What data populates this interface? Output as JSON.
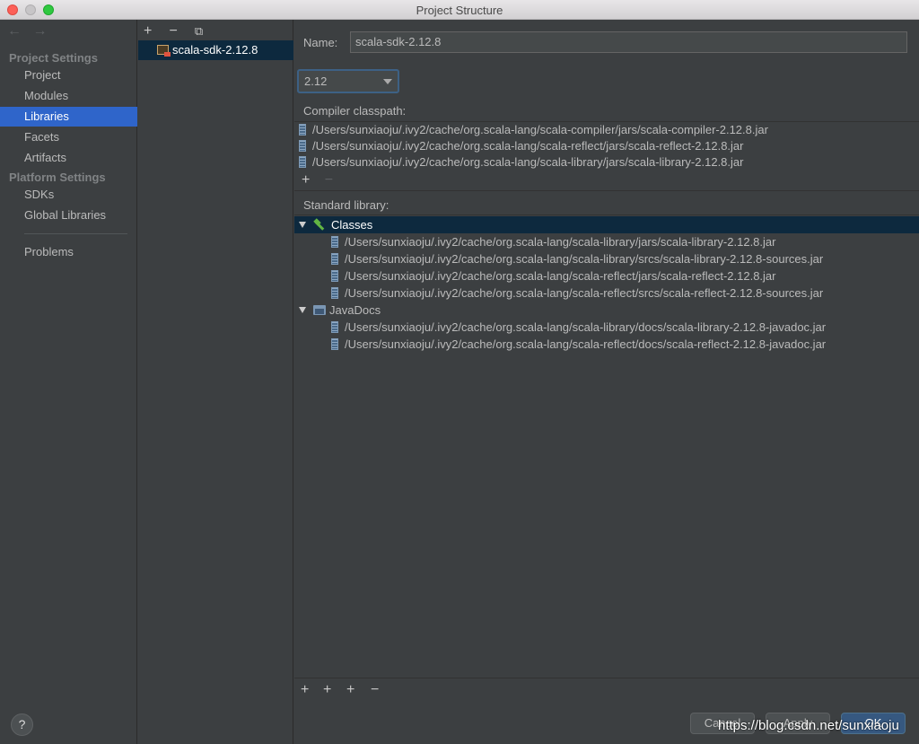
{
  "window": {
    "title": "Project Structure"
  },
  "nav": {
    "back": "←",
    "forward": "→",
    "project_settings": "Project Settings",
    "platform_settings": "Platform Settings",
    "items": {
      "project": "Project",
      "modules": "Modules",
      "libraries": "Libraries",
      "facets": "Facets",
      "artifacts": "Artifacts",
      "sdks": "SDKs",
      "global_libraries": "Global Libraries",
      "problems": "Problems"
    },
    "active": "Libraries"
  },
  "library_list": {
    "add": "+",
    "remove": "−",
    "copy": "⧉",
    "items": [
      "scala-sdk-2.12.8"
    ]
  },
  "details": {
    "name_label": "Name:",
    "name_value": "scala-sdk-2.12.8",
    "version": "2.12",
    "compiler_classpath_label": "Compiler classpath:",
    "compiler_classpath": [
      "/Users/sunxiaoju/.ivy2/cache/org.scala-lang/scala-compiler/jars/scala-compiler-2.12.8.jar",
      "/Users/sunxiaoju/.ivy2/cache/org.scala-lang/scala-reflect/jars/scala-reflect-2.12.8.jar",
      "/Users/sunxiaoju/.ivy2/cache/org.scala-lang/scala-library/jars/scala-library-2.12.8.jar"
    ],
    "cp_add": "+",
    "cp_remove": "−",
    "standard_library_label": "Standard library:",
    "classes_label": "Classes",
    "classes": [
      "/Users/sunxiaoju/.ivy2/cache/org.scala-lang/scala-library/jars/scala-library-2.12.8.jar",
      "/Users/sunxiaoju/.ivy2/cache/org.scala-lang/scala-library/srcs/scala-library-2.12.8-sources.jar",
      "/Users/sunxiaoju/.ivy2/cache/org.scala-lang/scala-reflect/jars/scala-reflect-2.12.8.jar",
      "/Users/sunxiaoju/.ivy2/cache/org.scala-lang/scala-reflect/srcs/scala-reflect-2.12.8-sources.jar"
    ],
    "javadocs_label": "JavaDocs",
    "javadocs": [
      "/Users/sunxiaoju/.ivy2/cache/org.scala-lang/scala-library/docs/scala-library-2.12.8-javadoc.jar",
      "/Users/sunxiaoju/.ivy2/cache/org.scala-lang/scala-reflect/docs/scala-reflect-2.12.8-javadoc.jar"
    ],
    "bottom_tools": {
      "add": "+",
      "add_root": "+",
      "attach": "+",
      "remove": "−"
    }
  },
  "footer": {
    "help": "?",
    "cancel": "Cancel",
    "apply": "Apply",
    "ok": "OK",
    "watermark": "https://blog.csdn.net/sunxiaoju"
  },
  "colors": {
    "background": "#3c3f41",
    "selection_active": "#2f65ca",
    "selection_inactive": "#0d293e",
    "primary_button": "#365880"
  }
}
